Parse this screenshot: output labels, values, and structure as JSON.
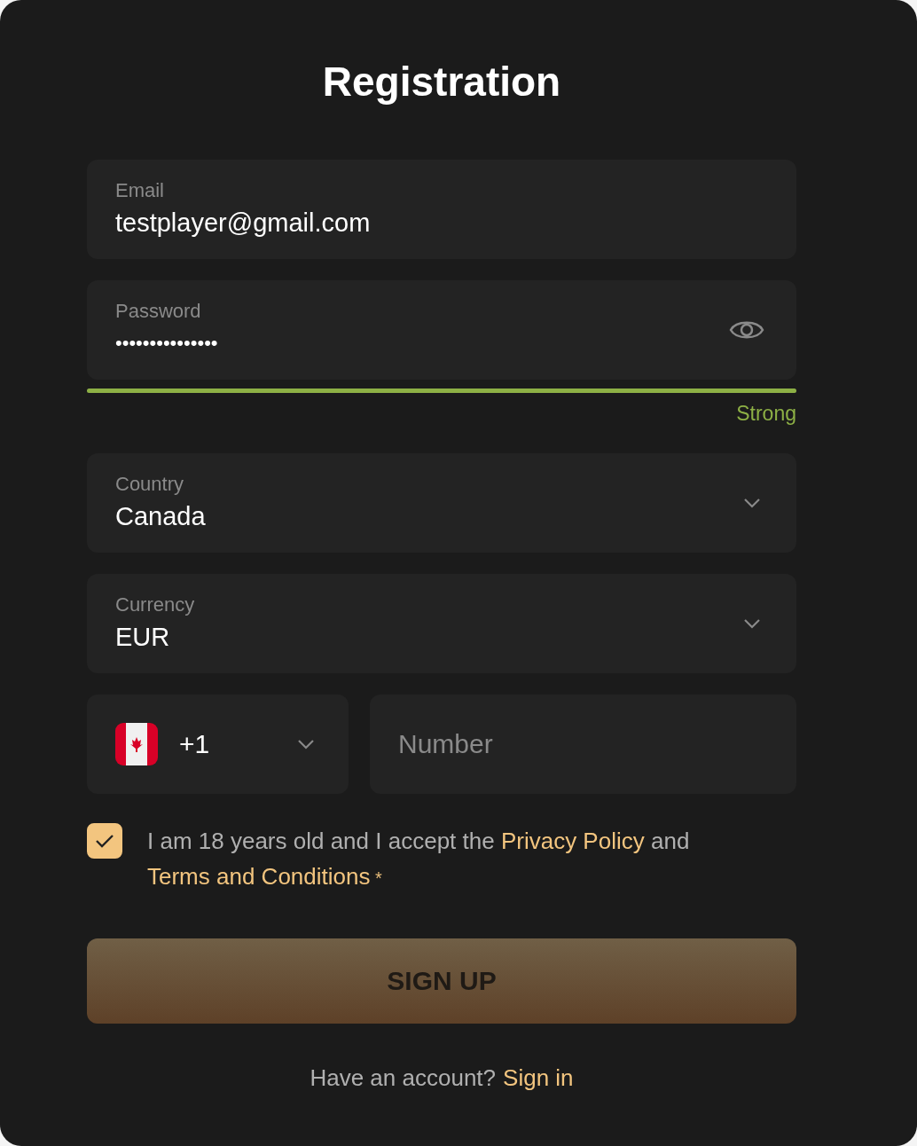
{
  "title": "Registration",
  "email": {
    "label": "Email",
    "value": "testplayer@gmail.com"
  },
  "password": {
    "label": "Password",
    "masked_value": "•••••••••••••••",
    "strength": {
      "level": 1,
      "label": "Strong"
    }
  },
  "country": {
    "label": "Country",
    "value": "Canada"
  },
  "currency": {
    "label": "Currency",
    "value": "EUR"
  },
  "phone": {
    "code": "+1",
    "placeholder": "Number"
  },
  "consent": {
    "checked": true,
    "parts": [
      {
        "kind": "text",
        "text": "I am 18 years old and I accept the "
      },
      {
        "kind": "link",
        "text": "Privacy Policy"
      },
      {
        "kind": "text",
        "text": " and "
      },
      {
        "kind": "link",
        "text": "Terms and Conditions"
      },
      {
        "kind": "mark",
        "text": " *"
      }
    ]
  },
  "submit": "SIGN UP",
  "footer": {
    "text": "Have an account?",
    "link": "Sign in"
  }
}
